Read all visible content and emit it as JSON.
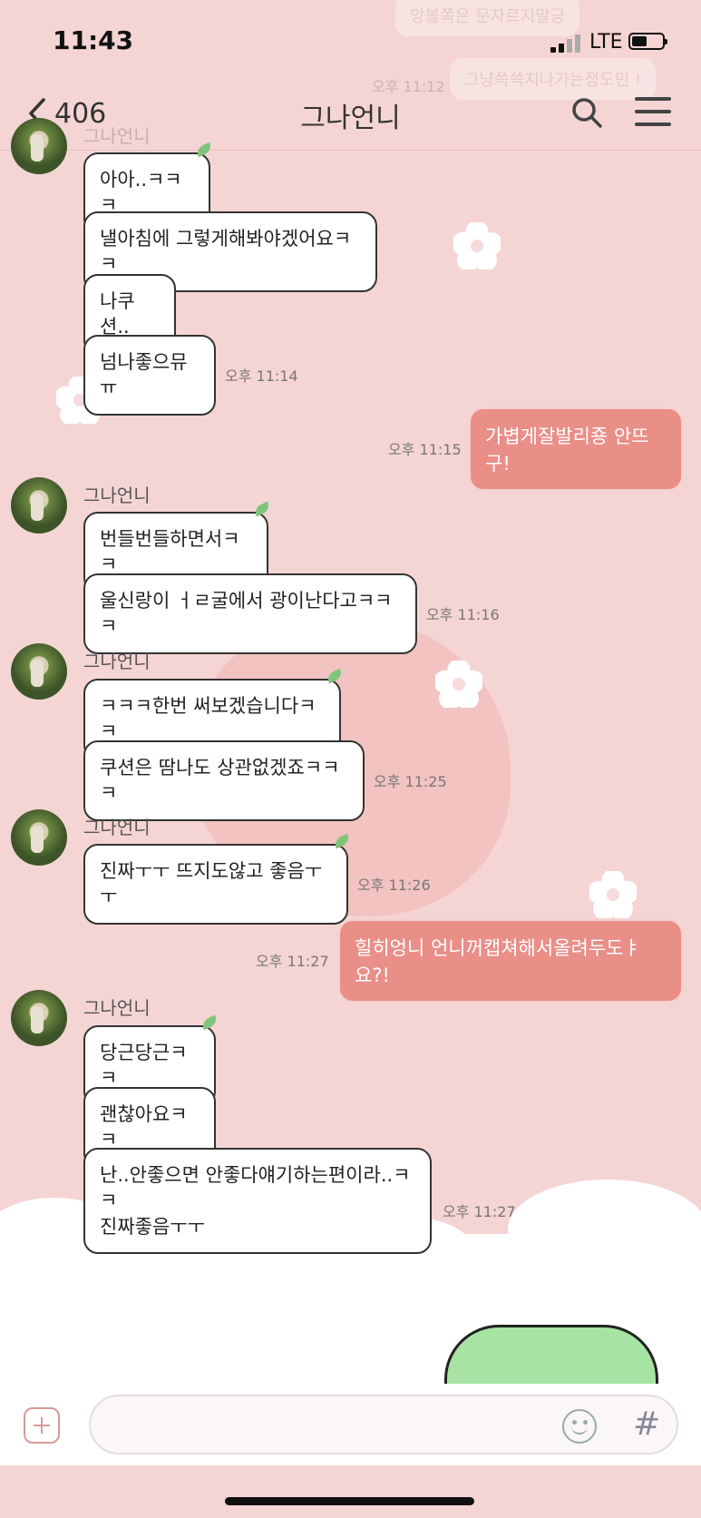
{
  "status_bar": {
    "time": "11:43",
    "network": "LTE"
  },
  "header": {
    "back_label": "406",
    "title": "그나언니"
  },
  "ghost_previews": [
    "앙볼쪽은 문자르지말긍",
    "오후 11:12",
    "그냥쓱쓱지나가는정도민 !"
  ],
  "conversation": [
    {
      "type": "incoming",
      "sender": "그나언니",
      "show_name": false,
      "show_avatar": true,
      "bubbles": [
        "아아..ㅋㅋㅋ",
        "낼아침에 그렇게해봐야겠어요ㅋㅋ",
        "나쿠션..",
        "넘나좋으뮤ㅠ"
      ],
      "time": "오후 11:14"
    },
    {
      "type": "outgoing",
      "text": "가볍게잘발리죵 안뜨구!",
      "time": "오후 11:15"
    },
    {
      "type": "incoming",
      "sender": "그나언니",
      "show_name": true,
      "bubbles": [
        "번들번들하면서ㅋㅋ",
        "울신랑이 ㅓㄹ굴에서 광이난다고ㅋㅋㅋ"
      ],
      "time": "오후 11:16"
    },
    {
      "type": "incoming",
      "sender": "그나언니",
      "show_name": true,
      "bubbles": [
        "ㅋㅋㅋ한번 써보겠습니다ㅋㅋ",
        "쿠션은 땀나도 상관없겠죠ㅋㅋㅋ"
      ],
      "time": "오후 11:25"
    },
    {
      "type": "incoming",
      "sender": "그나언니",
      "show_name": true,
      "bubbles": [
        "진짜ㅜㅜ 뜨지도않고 좋음ㅜㅜ"
      ],
      "time": "오후 11:26"
    },
    {
      "type": "outgoing",
      "text": "힐히엉니 언니꺼캡쳐해서올려두도ㅑ요?!",
      "time": "오후 11:27"
    },
    {
      "type": "incoming",
      "sender": "그나언니",
      "show_name": true,
      "bubbles": [
        "당근당근ㅋㅋ",
        "괜찮아요ㅋㅋ",
        "난..안좋으면 안좋다얘기하는편이라..ㅋㅋ\n진짜좋음ㅜㅜ"
      ],
      "time": "오후 11:27"
    }
  ],
  "input_bar": {
    "placeholder": "",
    "hash_symbol": "#"
  },
  "colors": {
    "background": "#f5d5d4",
    "outgoing_bubble": "#ea8e88",
    "incoming_bubble": "#ffffff"
  }
}
